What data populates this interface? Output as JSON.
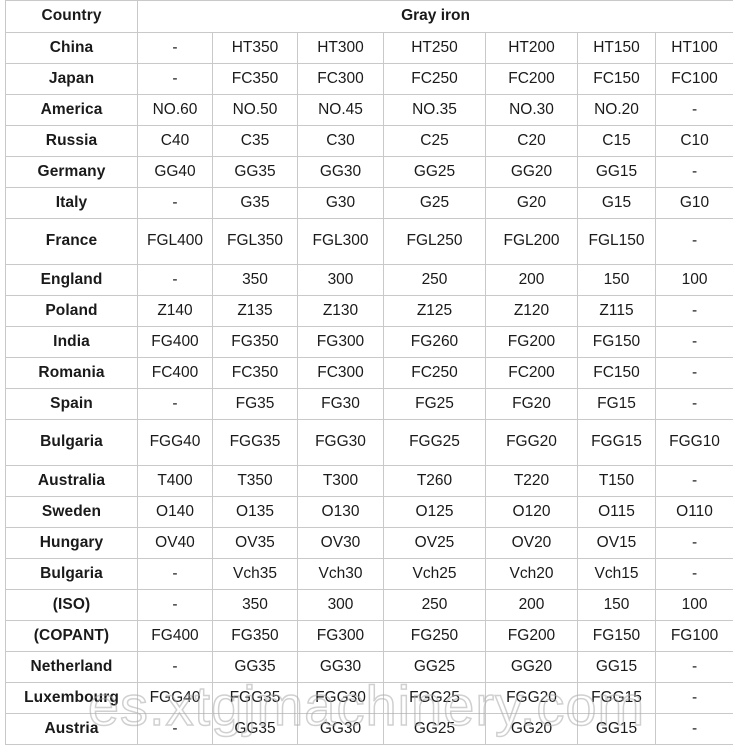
{
  "table": {
    "header": {
      "country_label": "Country",
      "group_label": "Gray iron"
    },
    "rows": [
      {
        "country": "China",
        "values": [
          "-",
          "HT350",
          "HT300",
          "HT250",
          "HT200",
          "HT150",
          "HT100"
        ]
      },
      {
        "country": "Japan",
        "values": [
          "-",
          "FC350",
          "FC300",
          "FC250",
          "FC200",
          "FC150",
          "FC100"
        ]
      },
      {
        "country": "America",
        "values": [
          "NO.60",
          "NO.50",
          "NO.45",
          "NO.35",
          "NO.30",
          "NO.20",
          "-"
        ]
      },
      {
        "country": "Russia",
        "values": [
          "C40",
          "C35",
          "C30",
          "C25",
          "C20",
          "C15",
          "C10"
        ]
      },
      {
        "country": "Germany",
        "values": [
          "GG40",
          "GG35",
          "GG30",
          "GG25",
          "GG20",
          "GG15",
          "-"
        ]
      },
      {
        "country": "Italy",
        "values": [
          "-",
          "G35",
          "G30",
          "G25",
          "G20",
          "G15",
          "G10"
        ]
      },
      {
        "country": "France",
        "values": [
          "FGL400",
          "FGL350",
          "FGL300",
          "FGL250",
          "FGL200",
          "FGL150",
          "-"
        ],
        "tall": true
      },
      {
        "country": "England",
        "values": [
          "-",
          "350",
          "300",
          "250",
          "200",
          "150",
          "100"
        ]
      },
      {
        "country": "Poland",
        "values": [
          "Z140",
          "Z135",
          "Z130",
          "Z125",
          "Z120",
          "Z115",
          "-"
        ]
      },
      {
        "country": "India",
        "values": [
          "FG400",
          "FG350",
          "FG300",
          "FG260",
          "FG200",
          "FG150",
          "-"
        ]
      },
      {
        "country": "Romania",
        "values": [
          "FC400",
          "FC350",
          "FC300",
          "FC250",
          "FC200",
          "FC150",
          "-"
        ]
      },
      {
        "country": "Spain",
        "values": [
          "-",
          "FG35",
          "FG30",
          "FG25",
          "FG20",
          "FG15",
          "-"
        ]
      },
      {
        "country": "Bulgaria",
        "values": [
          "FGG40",
          "FGG35",
          "FGG30",
          "FGG25",
          "FGG20",
          "FGG15",
          "FGG10"
        ],
        "tall": true
      },
      {
        "country": "Australia",
        "values": [
          "T400",
          "T350",
          "T300",
          "T260",
          "T220",
          "T150",
          "-"
        ]
      },
      {
        "country": "Sweden",
        "values": [
          "O140",
          "O135",
          "O130",
          "O125",
          "O120",
          "O115",
          "O110"
        ]
      },
      {
        "country": "Hungary",
        "values": [
          "OV40",
          "OV35",
          "OV30",
          "OV25",
          "OV20",
          "OV15",
          "-"
        ]
      },
      {
        "country": "Bulgaria",
        "values": [
          "-",
          "Vch35",
          "Vch30",
          "Vch25",
          "Vch20",
          "Vch15",
          "-"
        ]
      },
      {
        "country": "(ISO)",
        "values": [
          "-",
          "350",
          "300",
          "250",
          "200",
          "150",
          "100"
        ]
      },
      {
        "country": "(COPANT)",
        "values": [
          "FG400",
          "FG350",
          "FG300",
          "FG250",
          "FG200",
          "FG150",
          "FG100"
        ]
      },
      {
        "country": "Netherland",
        "values": [
          "-",
          "GG35",
          "GG30",
          "GG25",
          "GG20",
          "GG15",
          "-"
        ]
      },
      {
        "country": "Luxembourg",
        "values": [
          "FGG40",
          "FGG35",
          "FGG30",
          "FGG25",
          "FGG20",
          "FGG15",
          "-"
        ]
      },
      {
        "country": "Austria",
        "values": [
          "-",
          "GG35",
          "GG30",
          "GG25",
          "GG20",
          "GG15",
          "-"
        ]
      }
    ]
  },
  "watermark": {
    "text": "es.xtgjmachinery.com"
  },
  "colors": {
    "border": "#c9c9c9",
    "text": "#1a1a1a",
    "background": "#ffffff",
    "watermark": "#aaaaaa"
  }
}
